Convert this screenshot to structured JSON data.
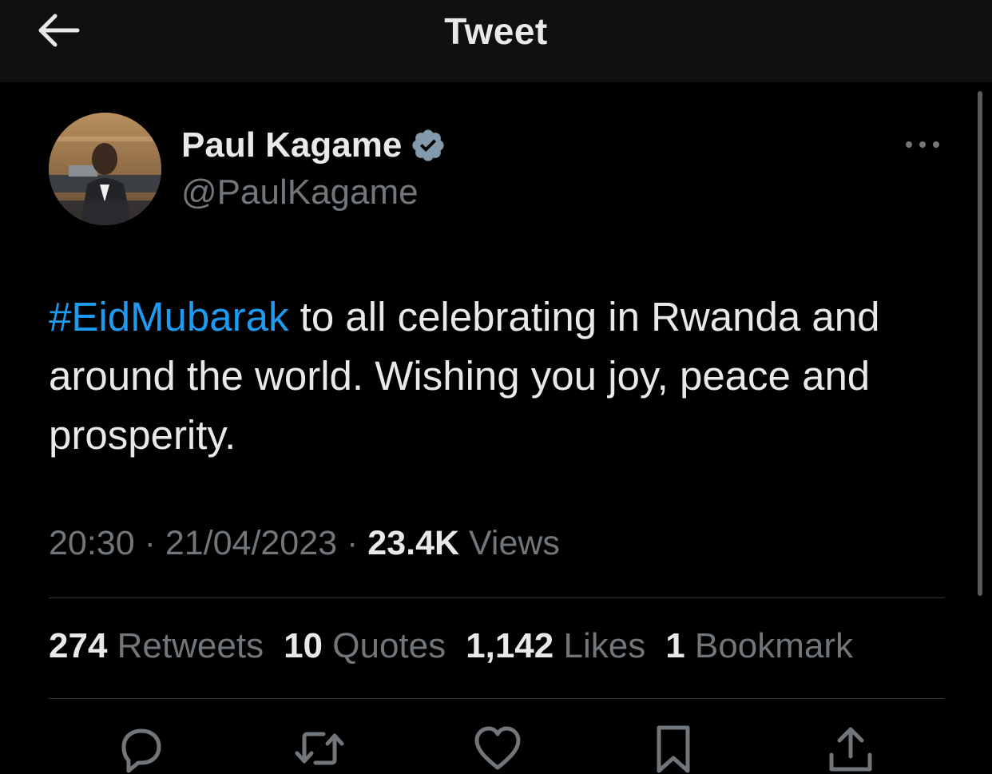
{
  "header": {
    "title": "Tweet"
  },
  "author": {
    "name": "Paul Kagame",
    "handle": "@PaulKagame",
    "verified": true
  },
  "tweet": {
    "hashtag": "#EidMubarak",
    "text": " to all celebrating in Rwanda and around the world. Wishing you joy, peace and prosperity."
  },
  "meta": {
    "time": "20:30",
    "date": "21/04/2023",
    "separator": "·",
    "views_count": "23.4K",
    "views_label": "Views"
  },
  "stats": {
    "retweets": {
      "count": "274",
      "label": "Retweets"
    },
    "quotes": {
      "count": "10",
      "label": "Quotes"
    },
    "likes": {
      "count": "1,142",
      "label": "Likes"
    },
    "bookmarks": {
      "count": "1",
      "label": "Bookmark"
    }
  },
  "colors": {
    "accent": "#1d9bf0",
    "background": "#000000",
    "header_background": "#101010",
    "text_primary": "#e7e9ea",
    "text_secondary": "#71767b",
    "verified_badge": "#829aab"
  },
  "icons": {
    "back": "arrow-left-icon",
    "verified": "verified-badge-icon",
    "more": "more-horizontal-icon",
    "reply": "reply-icon",
    "retweet": "retweet-icon",
    "like": "heart-icon",
    "bookmark": "bookmark-icon",
    "share": "share-icon"
  }
}
